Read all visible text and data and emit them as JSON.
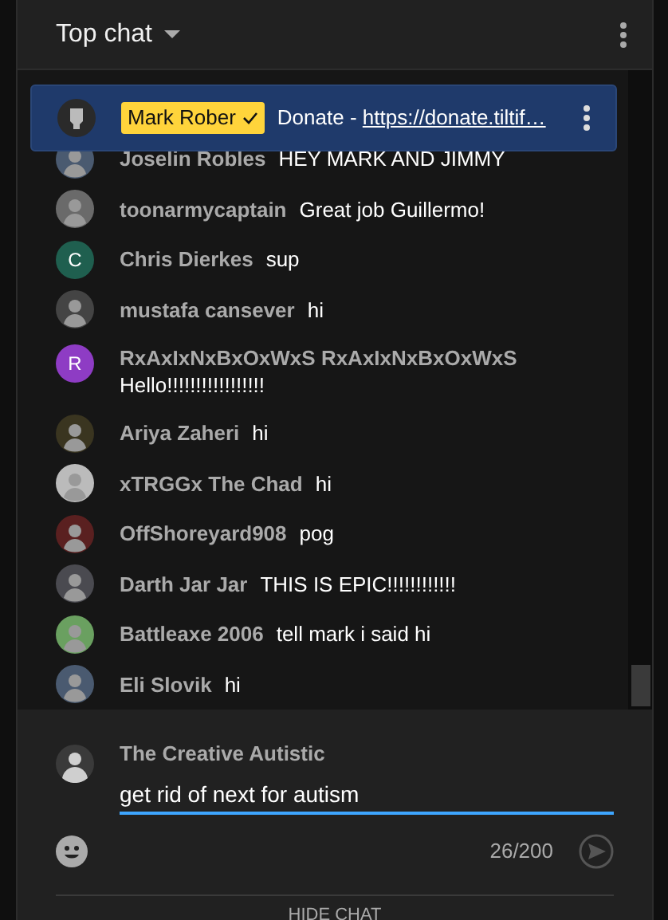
{
  "header": {
    "title": "Top chat"
  },
  "pinned": {
    "author": "Mark Rober",
    "verified": true,
    "message": "Donate - ",
    "link": "https://donate.tiltif…"
  },
  "messages": [
    {
      "author": "Joselin Robles",
      "text": "HEY MARK AND JIMMY",
      "avatar": {
        "kind": "photo"
      }
    },
    {
      "author": "toonarmycaptain",
      "text": "Great job Guillermo!",
      "avatar": {
        "kind": "photo"
      }
    },
    {
      "author": "Chris Dierkes",
      "text": "sup",
      "avatar": {
        "kind": "letter",
        "letter": "C",
        "color": "#1f5f4f"
      }
    },
    {
      "author": "mustafa cansever",
      "text": "hi",
      "avatar": {
        "kind": "photo"
      }
    },
    {
      "author": "RxAxIxNxBxOxWxS RxAxIxNxBxOxWxS",
      "text": "Hello!!!!!!!!!!!!!!!!!",
      "avatar": {
        "kind": "letter",
        "letter": "R",
        "color": "#8e3cc4"
      }
    },
    {
      "author": "Ariya Zaheri",
      "text": "hi",
      "avatar": {
        "kind": "photo"
      }
    },
    {
      "author": "xTRGGx The Chad",
      "text": "hi",
      "avatar": {
        "kind": "photo"
      }
    },
    {
      "author": "OffShoreyard908",
      "text": "pog",
      "avatar": {
        "kind": "photo"
      }
    },
    {
      "author": "Darth Jar Jar",
      "text": "THIS IS EPIC!!!!!!!!!!!!",
      "avatar": {
        "kind": "photo"
      }
    },
    {
      "author": "Battleaxe 2006",
      "text": "tell mark i said hi",
      "avatar": {
        "kind": "photo"
      }
    },
    {
      "author": "Eli Slovik",
      "text": "hi",
      "avatar": {
        "kind": "photo"
      }
    }
  ],
  "composer": {
    "author": "The Creative Autistic",
    "value": "get rid of next for autism",
    "count": "26/200"
  },
  "footer": {
    "button": "HIDE CHAT"
  }
}
